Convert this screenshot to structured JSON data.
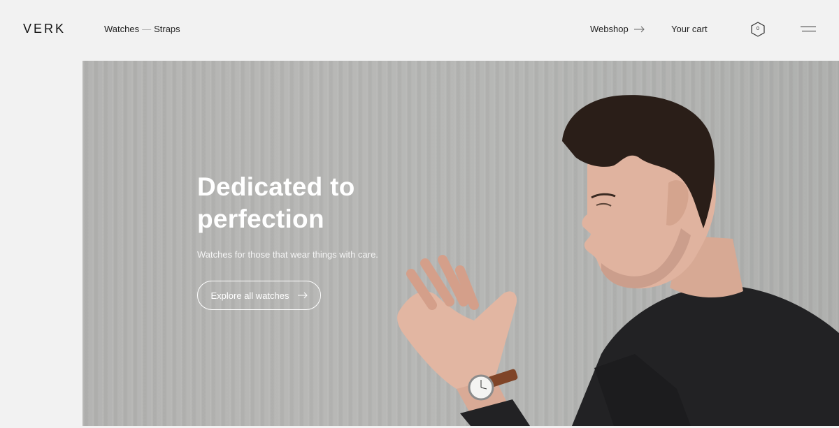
{
  "header": {
    "logo": "VERK",
    "nav": {
      "watches": "Watches",
      "separator": "—",
      "straps": "Straps"
    },
    "webshop": "Webshop",
    "cart": "Your cart",
    "cart_count": "0",
    "menu_icon": "hamburger-icon"
  },
  "hero": {
    "title_line1": "Dedicated to",
    "title_line2": "perfection",
    "subtitle": "Watches for those that wear things with care.",
    "cta": "Explore all watches",
    "cta_icon": "arrow-right-icon"
  },
  "colors": {
    "page_bg": "#f2f2f2",
    "hero_bg": "#b5b6b4",
    "sweater": "#232325",
    "skin": "#e3b9a3",
    "hair": "#2a1e18",
    "watch_strap": "#8a4a2a"
  }
}
